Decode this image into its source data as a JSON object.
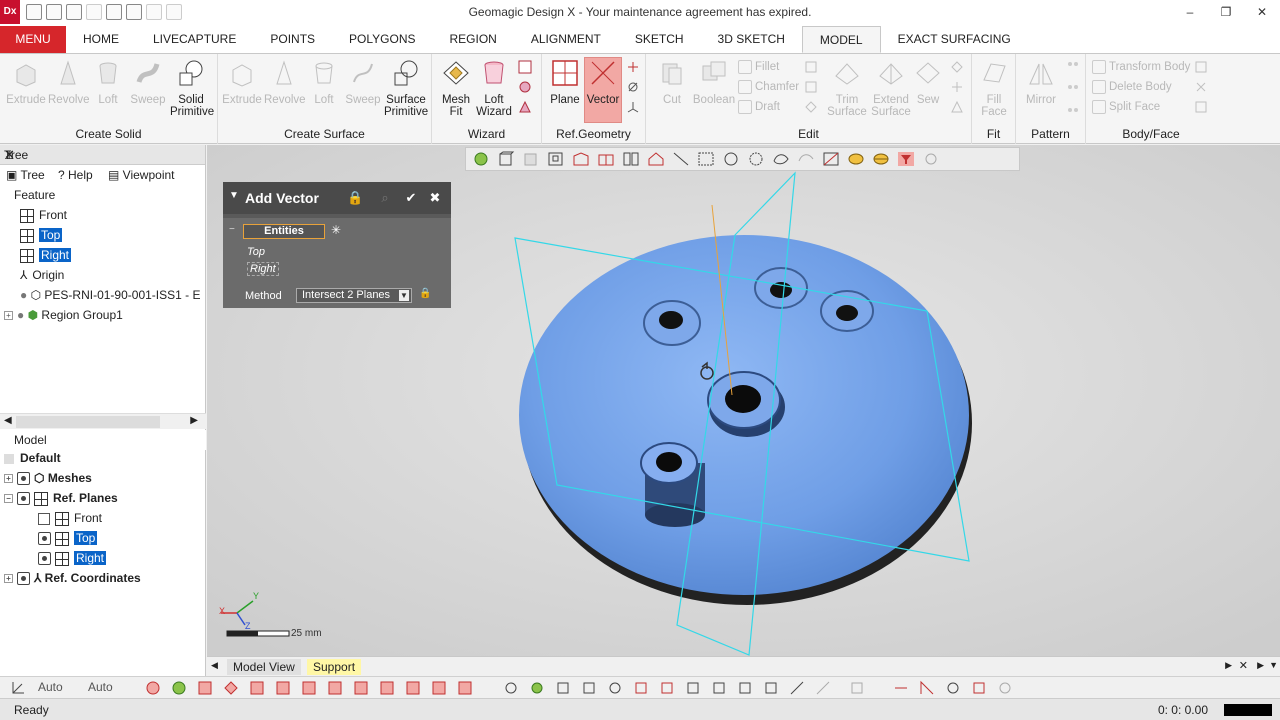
{
  "app": {
    "icon_text": "Dx",
    "title": "Geomagic Design X - Your maintenance agreement has expired.",
    "minimize": "–",
    "restore": "❐",
    "close": "✕"
  },
  "tabs": [
    "MENU",
    "HOME",
    "LIVECAPTURE",
    "POINTS",
    "POLYGONS",
    "REGION",
    "ALIGNMENT",
    "SKETCH",
    "3D SKETCH",
    "MODEL",
    "EXACT SURFACING"
  ],
  "ribbon": {
    "create_solid": {
      "label": "Create Solid",
      "extrude": "Extrude",
      "revolve": "Revolve",
      "loft": "Loft",
      "sweep": "Sweep",
      "solid_primitive_1": "Solid",
      "solid_primitive_2": "Primitive"
    },
    "create_surface": {
      "label": "Create Surface",
      "extrude": "Extrude",
      "revolve": "Revolve",
      "loft": "Loft",
      "sweep": "Sweep",
      "surface_primitive_1": "Surface",
      "surface_primitive_2": "Primitive"
    },
    "wizard": {
      "label": "Wizard",
      "mesh_fit_1": "Mesh",
      "mesh_fit_2": "Fit",
      "loft_wizard_1": "Loft",
      "loft_wizard_2": "Wizard"
    },
    "ref_geometry": {
      "label": "Ref.Geometry",
      "plane": "Plane",
      "vector": "Vector"
    },
    "edit": {
      "label": "Edit",
      "cut": "Cut",
      "boolean": "Boolean",
      "fillet": "Fillet",
      "chamfer": "Chamfer",
      "draft": "Draft",
      "trim_surface_1": "Trim",
      "trim_surface_2": "Surface",
      "extend_surface_1": "Extend",
      "extend_surface_2": "Surface",
      "sew": "Sew"
    },
    "fit": {
      "label": "Fit",
      "fill_face_1": "Fill",
      "fill_face_2": "Face"
    },
    "pattern": {
      "label": "Pattern",
      "mirror": "Mirror"
    },
    "body_face": {
      "label": "Body/Face",
      "transform_body": "Transform Body",
      "delete_body": "Delete Body",
      "split_face": "Split Face"
    }
  },
  "tree_panel": {
    "header": "Tree",
    "subtabs": [
      "Tree",
      "Help",
      "Viewpoint"
    ],
    "feature_label": "Feature",
    "items": [
      "Front",
      "Top",
      "Right",
      "Origin",
      "PES-RNI-01-90-001-ISS1 - E",
      "Region Group1"
    ]
  },
  "model_panel": {
    "header": "Model",
    "default": "Default",
    "meshes": "Meshes",
    "ref_planes": "Ref. Planes",
    "planes": [
      "Front",
      "Top",
      "Right"
    ],
    "ref_coordinates": "Ref. Coordinates"
  },
  "dialog": {
    "title": "Add Vector",
    "entities_label": "Entities",
    "entities": [
      "Top",
      "Right"
    ],
    "method_label": "Method",
    "method_value": "Intersect 2 Planes"
  },
  "viewport": {
    "scale_label": "25 mm",
    "axis_x": "X",
    "axis_y": "Y",
    "axis_z": "Z",
    "mesh_color": "#6f9ee6"
  },
  "view_tabs": {
    "model_view": "Model View",
    "support": "Support"
  },
  "bottom_toolbar": {
    "auto1": "Auto",
    "auto2": "Auto"
  },
  "status": {
    "text": "Ready",
    "time": "0: 0: 0.00"
  }
}
